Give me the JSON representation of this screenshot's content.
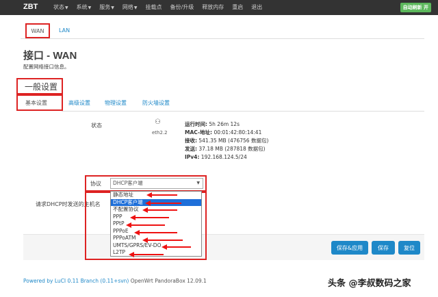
{
  "brand": "ZBT",
  "nav": [
    {
      "label": "状态",
      "caret": true
    },
    {
      "label": "系统",
      "caret": true
    },
    {
      "label": "服务",
      "caret": true
    },
    {
      "label": "网络",
      "caret": true
    },
    {
      "label": "挂载点",
      "caret": false
    },
    {
      "label": "备份/升级",
      "caret": false
    },
    {
      "label": "释放内存",
      "caret": false
    },
    {
      "label": "重启",
      "caret": false
    },
    {
      "label": "退出",
      "caret": false
    }
  ],
  "autorefresh": "自动刷新 开",
  "tabs": {
    "wan": "WAN",
    "lan": "LAN"
  },
  "page": {
    "title": "接口 - WAN",
    "desc": "配置网络接口信息。"
  },
  "section": {
    "title": "一般设置"
  },
  "subtabs": [
    "基本设置",
    "高级设置",
    "物理设置",
    "防火墙设置"
  ],
  "status": {
    "label": "状态",
    "iface": "eth2.2",
    "uptime_label": "运行时间:",
    "uptime": "5h 26m 12s",
    "mac_label": "MAC-地址:",
    "mac": "00:01:42:80:14:41",
    "rx_label": "接收:",
    "rx": "541.35 MB (476756 数据包)",
    "tx_label": "发送:",
    "tx": "37.18 MB (287818 数据包)",
    "ipv4_label": "IPv4:",
    "ipv4": "192.168.124.5/24"
  },
  "protocol": {
    "label": "协议",
    "selected": "DHCP客户端",
    "options": [
      "静态地址",
      "DHCP客户端",
      "不配置协议",
      "PPP",
      "PPtP",
      "PPPoE",
      "PPPoATM",
      "UMTS/GPRS/EV-DO",
      "L2TP"
    ],
    "selected_index": 1
  },
  "hostname_label": "请求DHCP时发送的主机名",
  "buttons": {
    "save_apply": "保存&应用",
    "save": "保存",
    "reset": "复位"
  },
  "footer": {
    "link": "Powered by LuCI 0.11 Branch (0.11+svn)",
    "rest": " OpenWrt PandoraBox 12.09.1"
  },
  "watermark": "头条 @李叔数码之家",
  "colors": {
    "accent": "#1e88c8",
    "highlight": "#d22",
    "topbar": "#333",
    "success": "#5cb85c"
  }
}
